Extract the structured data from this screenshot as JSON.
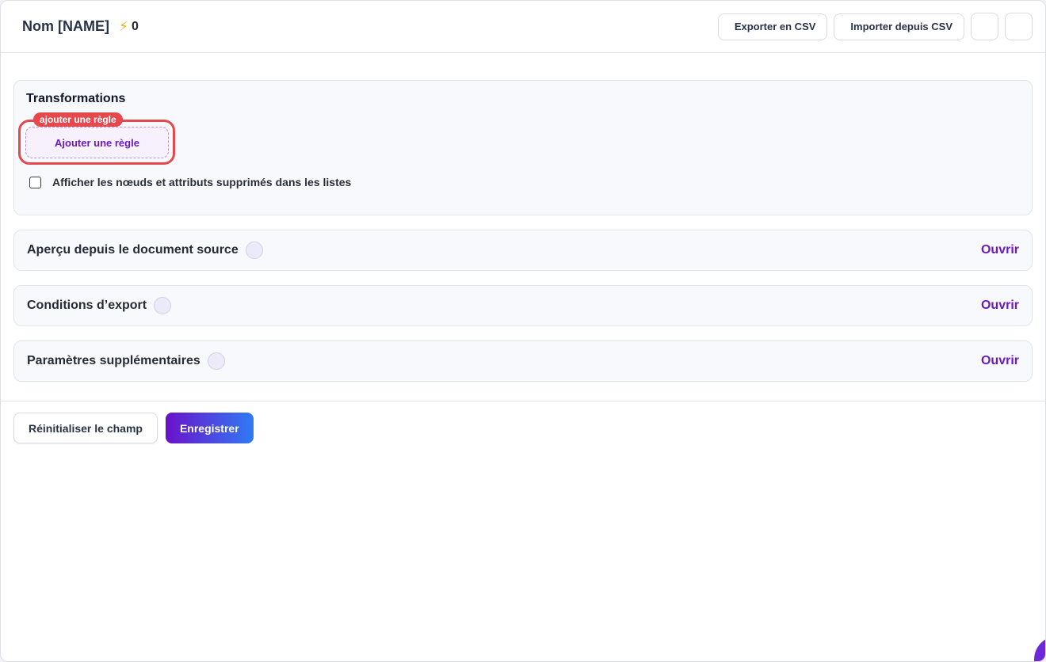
{
  "header": {
    "title": "Nom [NAME]",
    "bolt_icon": "lightning-icon",
    "count": "0",
    "export_csv_label": "Exporter en CSV",
    "import_csv_label": "Importer depuis CSV"
  },
  "transformations": {
    "title": "Transformations",
    "highlight_tag": "ajouter une règle",
    "add_rule_label": "Ajouter une règle",
    "show_deleted_label": "Afficher les nœuds et attributs supprimés dans les listes",
    "show_deleted_checked": false
  },
  "sections": [
    {
      "title": "Aperçu depuis le document source",
      "action": "Ouvrir"
    },
    {
      "title": "Conditions d’export",
      "action": "Ouvrir"
    },
    {
      "title": "Paramètres supplémentaires",
      "action": "Ouvrir"
    }
  ],
  "footer": {
    "reset_label": "Réinitialiser le champ",
    "save_label": "Enregistrer"
  },
  "colors": {
    "accent": "#6a1bc0",
    "highlight": "#e5484d",
    "save_gradient_start": "#6a12c9",
    "save_gradient_end": "#2f7bf5",
    "bolt": "#f2b01e"
  }
}
